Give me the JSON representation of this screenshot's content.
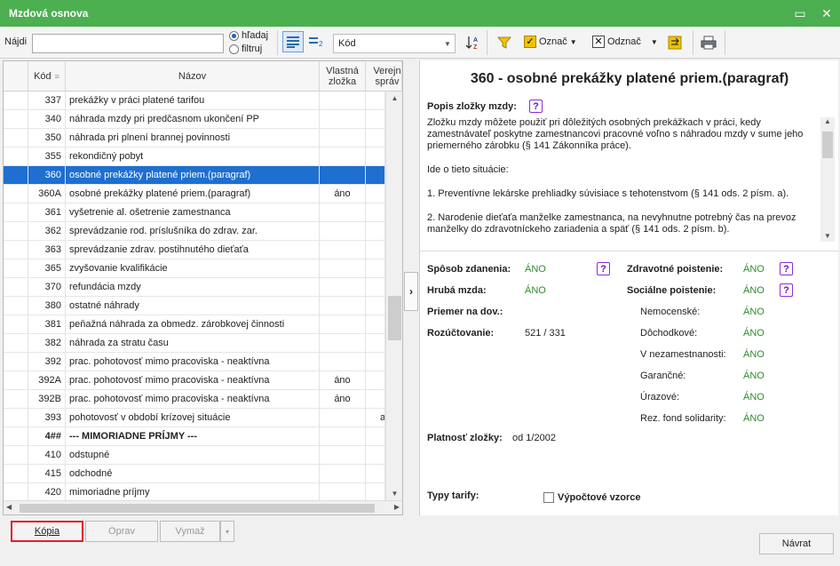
{
  "window": {
    "title": "Mzdová osnova"
  },
  "toolbar": {
    "find_label": "Nájdi",
    "find_value": "",
    "radio_search": "hľadaj",
    "radio_filter": "filtruj",
    "sort_select": "Kód",
    "mark_label": "Označ",
    "unmark_label": "Odznač"
  },
  "table": {
    "headers": {
      "code": "Kód",
      "name": "Názov",
      "own": "Vlastná zložka",
      "pub": "Verejn správ"
    },
    "rows": [
      {
        "code": "337",
        "name": "prekážky v práci platené tarifou",
        "own": "",
        "pub": ""
      },
      {
        "code": "340",
        "name": "náhrada mzdy pri predčasnom ukončení PP",
        "own": "",
        "pub": ""
      },
      {
        "code": "350",
        "name": "náhrada pri plnení brannej povinnosti",
        "own": "",
        "pub": ""
      },
      {
        "code": "355",
        "name": "rekondičný pobyt",
        "own": "",
        "pub": ""
      },
      {
        "code": "360",
        "name": "osobné prekážky platené priem.(paragraf)",
        "own": "",
        "pub": "",
        "selected": true
      },
      {
        "code": "360A",
        "name": "osobné prekážky platené priem.(paragraf)",
        "own": "áno",
        "pub": ""
      },
      {
        "code": "361",
        "name": "vyšetrenie al. ošetrenie zamestnanca",
        "own": "",
        "pub": ""
      },
      {
        "code": "362",
        "name": "sprevádzanie rod. príslušníka do zdrav. zar.",
        "own": "",
        "pub": ""
      },
      {
        "code": "363",
        "name": "sprevádzanie zdrav. postihnutého dieťaťa",
        "own": "",
        "pub": ""
      },
      {
        "code": "365",
        "name": "zvyšovanie kvalifikácie",
        "own": "",
        "pub": ""
      },
      {
        "code": "370",
        "name": "refundácia mzdy",
        "own": "",
        "pub": ""
      },
      {
        "code": "380",
        "name": "ostatné náhrady",
        "own": "",
        "pub": ""
      },
      {
        "code": "381",
        "name": "peňažná náhrada za obmedz. zárobkovej činnosti",
        "own": "",
        "pub": ""
      },
      {
        "code": "382",
        "name": "náhrada za stratu času",
        "own": "",
        "pub": ""
      },
      {
        "code": "392",
        "name": "prac. pohotovosť mimo pracoviska - neaktívna",
        "own": "",
        "pub": ""
      },
      {
        "code": "392A",
        "name": "prac. pohotovosť mimo pracoviska - neaktívna",
        "own": "áno",
        "pub": ""
      },
      {
        "code": "392B",
        "name": "prac. pohotovosť mimo pracoviska - neaktívna",
        "own": "áno",
        "pub": ""
      },
      {
        "code": "393",
        "name": "pohotovosť v období krízovej situácie",
        "own": "",
        "pub": "a"
      },
      {
        "code": "4##",
        "name": "--- MIMORIADNE PRÍJMY ---",
        "own": "",
        "pub": "",
        "group": true
      },
      {
        "code": "410",
        "name": "odstupné",
        "own": "",
        "pub": ""
      },
      {
        "code": "415",
        "name": "odchodné",
        "own": "",
        "pub": ""
      },
      {
        "code": "420",
        "name": "mimoriadne príjmy",
        "own": "",
        "pub": ""
      }
    ]
  },
  "detail": {
    "title": "360 - osobné prekážky platené priem.(paragraf)",
    "desc_label": "Popis zložky mzdy:",
    "desc_p1": "Zložku mzdy môžete použiť pri dôležitých osobných prekážkach v práci, kedy zamestnávateľ poskytne zamestnancovi pracovné voľno s náhradou mzdy v sume jeho priemerného zárobku (§ 141 Zákonníka práce).",
    "desc_p2": "Ide o tieto situácie:",
    "desc_p3": "1. Preventívne lekárske prehliadky súvisiace s tehotenstvom (§ 141 ods. 2 písm. a).",
    "desc_p4": "2. Narodenie dieťaťa manželke zamestnanca, na nevyhnutne potrebný čas na prevoz manželky do zdravotníckeho zariadenia a späť (§ 141 ods. 2 písm. b).",
    "tax_label": "Spôsob zdanenia:",
    "tax_val": "ÁNO",
    "gross_label": "Hrubá mzda:",
    "gross_val": "ÁNO",
    "avg_label": "Priemer na dov.:",
    "acc_label": "Rozúčtovanie:",
    "acc_val": "521 / 331",
    "health_label": "Zdravotné poistenie:",
    "health_val": "ÁNO",
    "social_label": "Sociálne poistenie:",
    "social_val": "ÁNO",
    "sub": [
      {
        "label": "Nemocenské:",
        "val": "ÁNO"
      },
      {
        "label": "Dôchodkové:",
        "val": "ÁNO"
      },
      {
        "label": "V nezamestnanosti:",
        "val": "ÁNO"
      },
      {
        "label": "Garančné:",
        "val": "ÁNO"
      },
      {
        "label": "Úrazové:",
        "val": "ÁNO"
      },
      {
        "label": "Rez. fond solidarity:",
        "val": "ÁNO"
      }
    ],
    "valid_label": "Platnosť zložky:",
    "valid_val": "od 1/2002",
    "tariff_label": "Typy tarify:",
    "formula_label": "Výpočtové vzorce"
  },
  "buttons": {
    "copy": "Kópia",
    "edit": "Oprav",
    "delete": "Vymaž",
    "back": "Návrat"
  }
}
